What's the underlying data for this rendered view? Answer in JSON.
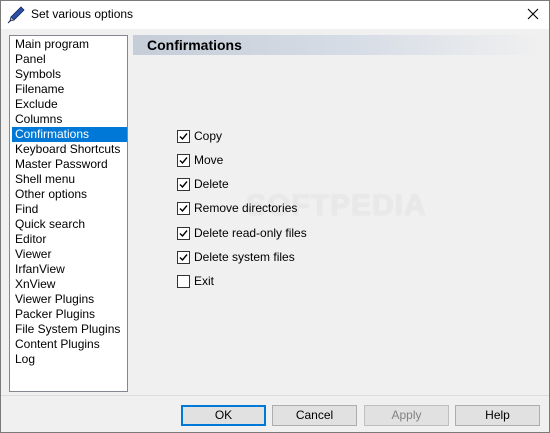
{
  "window": {
    "title": "Set various options",
    "app_icon": "pen-nib-icon",
    "close_icon": "close-icon"
  },
  "sidebar": {
    "selected_index": 6,
    "items": [
      {
        "label": "Main program"
      },
      {
        "label": "Panel"
      },
      {
        "label": "Symbols"
      },
      {
        "label": "Filename"
      },
      {
        "label": "Exclude"
      },
      {
        "label": "Columns"
      },
      {
        "label": "Confirmations"
      },
      {
        "label": "Keyboard Shortcuts"
      },
      {
        "label": "Master Password"
      },
      {
        "label": "Shell menu"
      },
      {
        "label": "Other options"
      },
      {
        "label": "Find"
      },
      {
        "label": "Quick search"
      },
      {
        "label": "Editor"
      },
      {
        "label": "Viewer"
      },
      {
        "label": "IrfanView"
      },
      {
        "label": "XnView"
      },
      {
        "label": "Viewer Plugins"
      },
      {
        "label": "Packer Plugins"
      },
      {
        "label": "File System Plugins"
      },
      {
        "label": "Content Plugins"
      },
      {
        "label": "Log"
      }
    ]
  },
  "panel": {
    "title": "Confirmations",
    "options": [
      {
        "label": "Copy",
        "checked": true
      },
      {
        "label": "Move",
        "checked": true
      },
      {
        "label": "Delete",
        "checked": true
      },
      {
        "label": "Remove directories",
        "checked": true
      },
      {
        "label": "Delete read-only files",
        "checked": true
      },
      {
        "label": "Delete system files",
        "checked": true
      },
      {
        "label": "Exit",
        "checked": false
      }
    ]
  },
  "watermark": "SOFTPEDIA",
  "buttons": {
    "ok": "OK",
    "cancel": "Cancel",
    "apply": "Apply",
    "help": "Help"
  },
  "colors": {
    "selection": "#0078d7",
    "header_gradient_start": "#c5cdd8"
  }
}
